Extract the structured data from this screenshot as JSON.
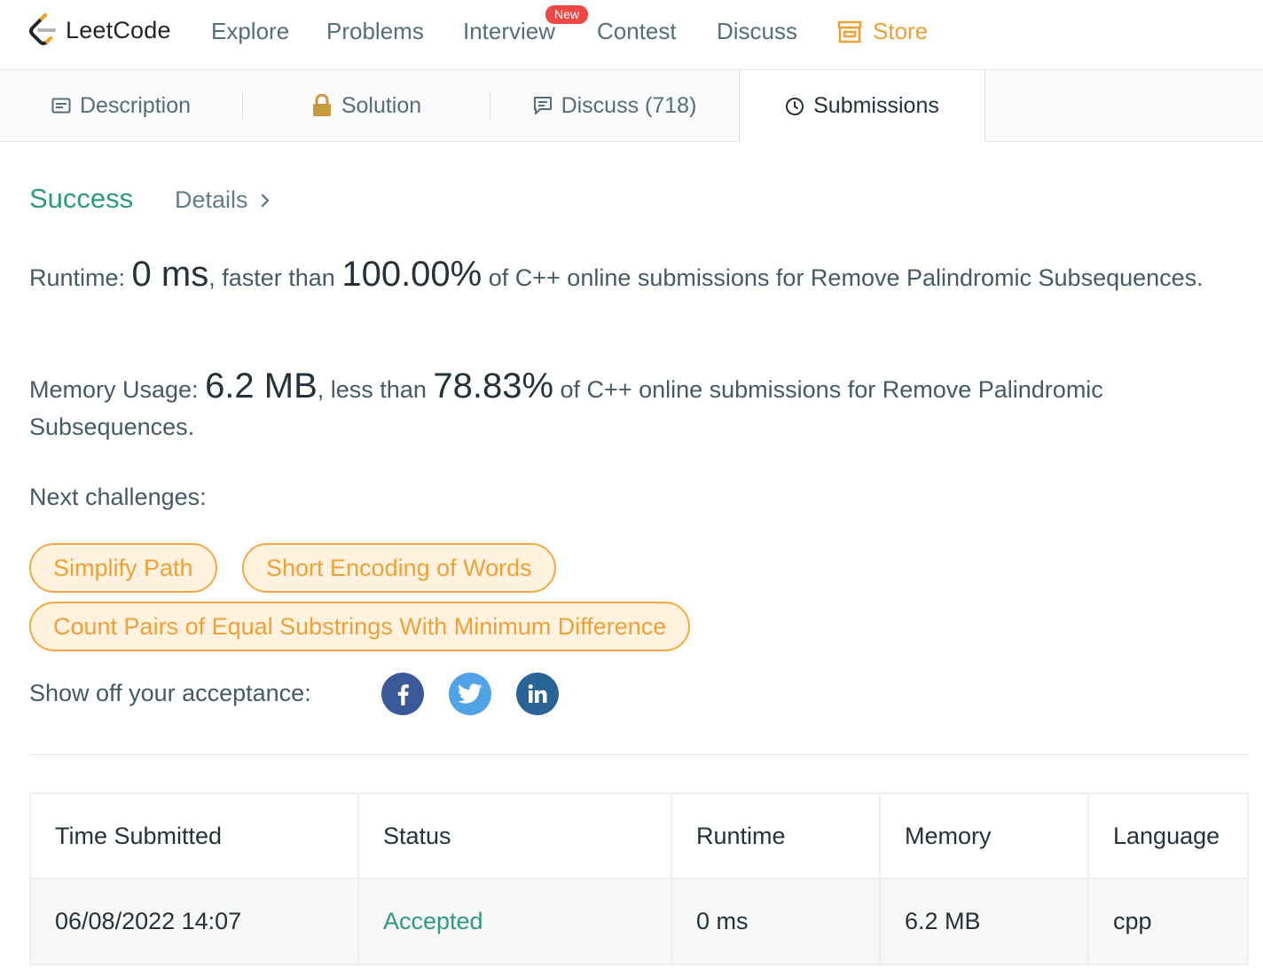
{
  "nav": {
    "logo_text": "LeetCode",
    "items": [
      "Explore",
      "Problems",
      "Interview",
      "Contest",
      "Discuss"
    ],
    "new_badge": "New",
    "store_label": "Store"
  },
  "tabs": {
    "description": "Description",
    "solution": "Solution",
    "discuss": "Discuss (718)",
    "submissions": "Submissions"
  },
  "result": {
    "status": "Success",
    "details_label": "Details",
    "runtime_prefix": "Runtime: ",
    "runtime_value": "0 ms",
    "runtime_mid": ", faster than ",
    "runtime_percent": "100.00%",
    "runtime_suffix": " of C++ online submissions for Remove Palindromic Subsequences.",
    "memory_prefix": "Memory Usage: ",
    "memory_value": "6.2 MB",
    "memory_mid": ", less than ",
    "memory_percent": "78.83%",
    "memory_suffix": " of C++ online submissions for Remove Palindromic Subsequences."
  },
  "next_challenges": {
    "label": "Next challenges:",
    "items": [
      "Simplify Path",
      "Short Encoding of Words",
      "Count Pairs of Equal Substrings With Minimum Difference"
    ]
  },
  "share": {
    "label": "Show off your acceptance:",
    "networks": [
      "facebook-icon",
      "twitter-icon",
      "linkedin-icon"
    ],
    "colors": {
      "facebook": "#3b5998",
      "twitter": "#4fa3e6",
      "linkedin": "#2a6496"
    }
  },
  "table": {
    "headers": [
      "Time Submitted",
      "Status",
      "Runtime",
      "Memory",
      "Language"
    ],
    "rows": [
      [
        "06/08/2022 14:07",
        "Accepted",
        "0 ms",
        "6.2 MB",
        "cpp"
      ]
    ]
  },
  "colors": {
    "accent_green": "#2e9a80",
    "accent_orange": "#f0a035",
    "badge_red": "#ef4743"
  }
}
